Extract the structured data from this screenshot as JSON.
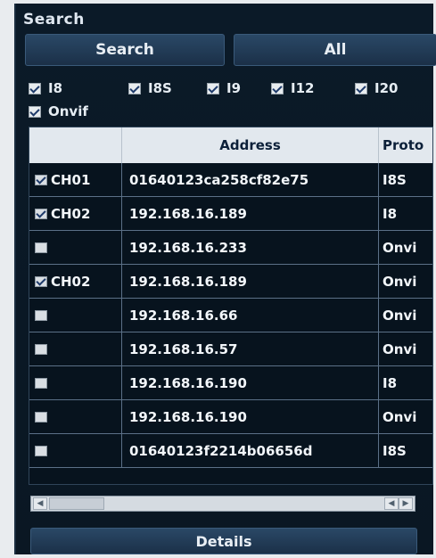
{
  "search_section": {
    "title": "Search",
    "search_button": "Search",
    "all_button": "All"
  },
  "protocol_filters": [
    {
      "label": "I8",
      "checked": true
    },
    {
      "label": "I8S",
      "checked": true
    },
    {
      "label": "I9",
      "checked": true
    },
    {
      "label": "I12",
      "checked": true
    },
    {
      "label": "I20",
      "checked": true
    },
    {
      "label": "Onvif",
      "checked": true
    }
  ],
  "table": {
    "columns": [
      "",
      "Address",
      "Proto"
    ],
    "rows": [
      {
        "checked": true,
        "channel": "CH01",
        "address": "01640123ca258cf82e75",
        "protocol": "I8S"
      },
      {
        "checked": true,
        "channel": "CH02",
        "address": "192.168.16.189",
        "protocol": "I8"
      },
      {
        "checked": false,
        "channel": "",
        "address": "192.168.16.233",
        "protocol": "Onvi"
      },
      {
        "checked": true,
        "channel": "CH02",
        "address": "192.168.16.189",
        "protocol": "Onvi"
      },
      {
        "checked": false,
        "channel": "",
        "address": "192.168.16.66",
        "protocol": "Onvi"
      },
      {
        "checked": false,
        "channel": "",
        "address": "192.168.16.57",
        "protocol": "Onvi"
      },
      {
        "checked": false,
        "channel": "",
        "address": "192.168.16.190",
        "protocol": "I8"
      },
      {
        "checked": false,
        "channel": "",
        "address": "192.168.16.190",
        "protocol": "Onvi"
      },
      {
        "checked": false,
        "channel": "",
        "address": "01640123f2214b06656d",
        "protocol": "I8S"
      }
    ]
  },
  "details_button": "Details",
  "icons": {
    "scroll_left": "chevron-left-icon",
    "scroll_right": "chevron-right-icon"
  },
  "colors": {
    "panel_bg": "#0b1a28",
    "button_bg": "#2a4866",
    "header_bg": "#e2e8ee"
  }
}
